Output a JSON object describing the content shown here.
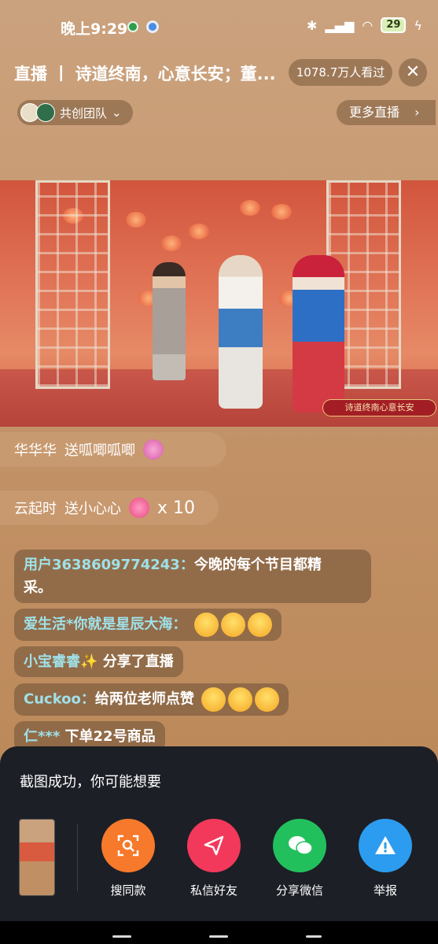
{
  "status_bar": {
    "time": "晚上9:29",
    "battery": "29"
  },
  "header": {
    "title": "直播 丨 诗道终南，心意长安；董...",
    "viewers": "1078.7万人看过",
    "team_label": "共创团队",
    "more_live": "更多直播"
  },
  "video": {
    "banner_text": "诗道终南心意长安"
  },
  "gifts": [
    {
      "user": "华华华",
      "text": "送呱唧呱唧",
      "count": ""
    },
    {
      "user": "云起时",
      "text": "送小心心",
      "count": "x 10"
    }
  ],
  "comments": [
    {
      "user": "用户3638609774243：",
      "text": "今晚的每个节目都精",
      "text2": "采。"
    },
    {
      "user": "爱生活*你就是星辰大海：",
      "text": ""
    },
    {
      "user": "小宝睿睿✨",
      "text": " 分享了直播"
    },
    {
      "user": "Cuckoo：",
      "text": "给两位老师点赞"
    },
    {
      "user": "仁***",
      "text": " 下单22号商品"
    }
  ],
  "share_panel": {
    "title": "截图成功，你可能想要",
    "actions": [
      {
        "label": "搜同款",
        "icon": "scan-search-icon",
        "color": "#f7792b"
      },
      {
        "label": "私信好友",
        "icon": "send-icon",
        "color": "#f2395b"
      },
      {
        "label": "分享微信",
        "icon": "wechat-icon",
        "color": "#22c05c"
      },
      {
        "label": "举报",
        "icon": "warning-icon",
        "color": "#2c9cf0"
      }
    ]
  }
}
